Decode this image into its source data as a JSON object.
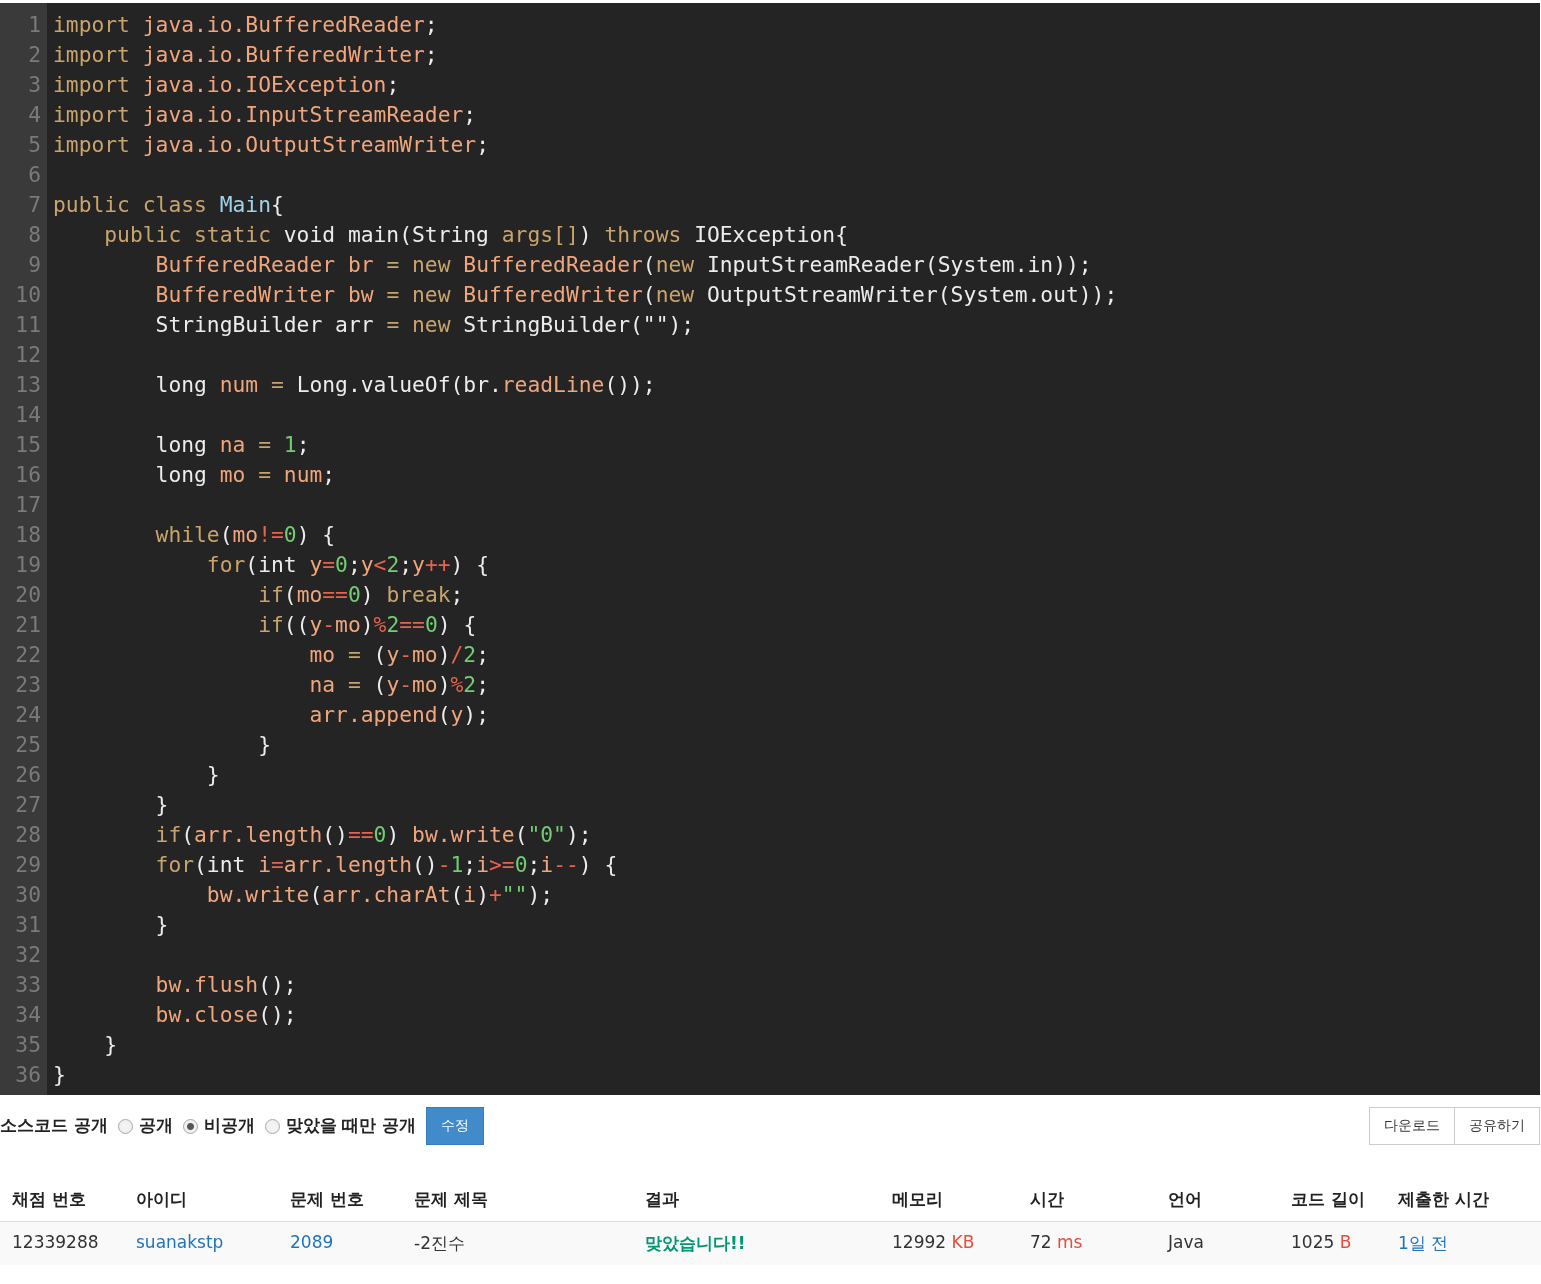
{
  "editor": {
    "lines": [
      {
        "number": "1",
        "tokens": [
          {
            "kind": "k",
            "text": "import "
          },
          {
            "kind": "v",
            "text": "java.io.BufferedReader"
          },
          {
            "kind": "w",
            "text": ";"
          }
        ]
      },
      {
        "number": "2",
        "tokens": [
          {
            "kind": "k",
            "text": "import "
          },
          {
            "kind": "v",
            "text": "java.io.BufferedWriter"
          },
          {
            "kind": "w",
            "text": ";"
          }
        ]
      },
      {
        "number": "3",
        "tokens": [
          {
            "kind": "k",
            "text": "import "
          },
          {
            "kind": "v",
            "text": "java.io.IOException"
          },
          {
            "kind": "w",
            "text": ";"
          }
        ]
      },
      {
        "number": "4",
        "tokens": [
          {
            "kind": "k",
            "text": "import "
          },
          {
            "kind": "v",
            "text": "java.io.InputStreamReader"
          },
          {
            "kind": "w",
            "text": ";"
          }
        ]
      },
      {
        "number": "5",
        "tokens": [
          {
            "kind": "k",
            "text": "import "
          },
          {
            "kind": "v",
            "text": "java.io.OutputStreamWriter"
          },
          {
            "kind": "w",
            "text": ";"
          }
        ]
      },
      {
        "number": "6"
      },
      {
        "number": "7",
        "tokens": [
          {
            "kind": "k",
            "text": "public class "
          },
          {
            "kind": "c",
            "text": "Main"
          },
          {
            "kind": "w",
            "text": "{"
          }
        ]
      },
      {
        "number": "8",
        "tokens": [
          {
            "kind": "k",
            "text": "    public static "
          },
          {
            "kind": "w",
            "text": "void main(String "
          },
          {
            "kind": "k",
            "text": "args[]"
          },
          {
            "kind": "w",
            "text": ") "
          },
          {
            "kind": "k",
            "text": "throws "
          },
          {
            "kind": "w",
            "text": "IOException{"
          }
        ]
      },
      {
        "number": "9",
        "tokens": [
          {
            "kind": "v",
            "text": "        BufferedReader br "
          },
          {
            "kind": "k",
            "text": "= new "
          },
          {
            "kind": "v",
            "text": "BufferedReader"
          },
          {
            "kind": "w",
            "text": "("
          },
          {
            "kind": "k",
            "text": "new "
          },
          {
            "kind": "w",
            "text": "InputStreamReader(System.in));"
          }
        ]
      },
      {
        "number": "10",
        "tokens": [
          {
            "kind": "v",
            "text": "        BufferedWriter bw "
          },
          {
            "kind": "k",
            "text": "= new "
          },
          {
            "kind": "v",
            "text": "BufferedWriter"
          },
          {
            "kind": "w",
            "text": "("
          },
          {
            "kind": "k",
            "text": "new "
          },
          {
            "kind": "w",
            "text": "OutputStreamWriter(System.out));"
          }
        ]
      },
      {
        "number": "11",
        "tokens": [
          {
            "kind": "w",
            "text": "        StringBuilder arr "
          },
          {
            "kind": "k",
            "text": "= new "
          },
          {
            "kind": "w",
            "text": "StringBuilder(\"\");"
          }
        ]
      },
      {
        "number": "12"
      },
      {
        "number": "13",
        "tokens": [
          {
            "kind": "w",
            "text": "        long "
          },
          {
            "kind": "v",
            "text": "num "
          },
          {
            "kind": "k",
            "text": "= "
          },
          {
            "kind": "w",
            "text": "Long.valueOf(br."
          },
          {
            "kind": "v",
            "text": "readLine"
          },
          {
            "kind": "w",
            "text": "());"
          }
        ]
      },
      {
        "number": "14"
      },
      {
        "number": "15",
        "tokens": [
          {
            "kind": "w",
            "text": "        long "
          },
          {
            "kind": "v",
            "text": "na "
          },
          {
            "kind": "k",
            "text": "= "
          },
          {
            "kind": "n",
            "text": "1"
          },
          {
            "kind": "w",
            "text": ";"
          }
        ]
      },
      {
        "number": "16",
        "tokens": [
          {
            "kind": "w",
            "text": "        long "
          },
          {
            "kind": "v",
            "text": "mo "
          },
          {
            "kind": "k",
            "text": "= "
          },
          {
            "kind": "v",
            "text": "num"
          },
          {
            "kind": "w",
            "text": ";"
          }
        ]
      },
      {
        "number": "17"
      },
      {
        "number": "18",
        "tokens": [
          {
            "kind": "k",
            "text": "        while"
          },
          {
            "kind": "w",
            "text": "("
          },
          {
            "kind": "v",
            "text": "mo"
          },
          {
            "kind": "o",
            "text": "!="
          },
          {
            "kind": "n",
            "text": "0"
          },
          {
            "kind": "w",
            "text": ") {"
          }
        ]
      },
      {
        "number": "19",
        "tokens": [
          {
            "kind": "k",
            "text": "            for"
          },
          {
            "kind": "w",
            "text": "(int "
          },
          {
            "kind": "v",
            "text": "y"
          },
          {
            "kind": "o",
            "text": "="
          },
          {
            "kind": "n",
            "text": "0"
          },
          {
            "kind": "w",
            "text": ";"
          },
          {
            "kind": "v",
            "text": "y"
          },
          {
            "kind": "o",
            "text": "<"
          },
          {
            "kind": "n",
            "text": "2"
          },
          {
            "kind": "w",
            "text": ";"
          },
          {
            "kind": "v",
            "text": "y"
          },
          {
            "kind": "o",
            "text": "++"
          },
          {
            "kind": "w",
            "text": ") {"
          }
        ]
      },
      {
        "number": "20",
        "tokens": [
          {
            "kind": "k",
            "text": "                if"
          },
          {
            "kind": "w",
            "text": "("
          },
          {
            "kind": "v",
            "text": "mo"
          },
          {
            "kind": "o",
            "text": "=="
          },
          {
            "kind": "n",
            "text": "0"
          },
          {
            "kind": "w",
            "text": ") "
          },
          {
            "kind": "k",
            "text": "break"
          },
          {
            "kind": "w",
            "text": ";"
          }
        ]
      },
      {
        "number": "21",
        "tokens": [
          {
            "kind": "k",
            "text": "                if"
          },
          {
            "kind": "w",
            "text": "(("
          },
          {
            "kind": "v",
            "text": "y"
          },
          {
            "kind": "o",
            "text": "-"
          },
          {
            "kind": "v",
            "text": "mo"
          },
          {
            "kind": "w",
            "text": ")"
          },
          {
            "kind": "o",
            "text": "%"
          },
          {
            "kind": "n",
            "text": "2"
          },
          {
            "kind": "o",
            "text": "=="
          },
          {
            "kind": "n",
            "text": "0"
          },
          {
            "kind": "w",
            "text": ") {"
          }
        ]
      },
      {
        "number": "22",
        "tokens": [
          {
            "kind": "v",
            "text": "                    mo "
          },
          {
            "kind": "k",
            "text": "= "
          },
          {
            "kind": "w",
            "text": "("
          },
          {
            "kind": "v",
            "text": "y"
          },
          {
            "kind": "o",
            "text": "-"
          },
          {
            "kind": "v",
            "text": "mo"
          },
          {
            "kind": "w",
            "text": ")"
          },
          {
            "kind": "o",
            "text": "/"
          },
          {
            "kind": "n",
            "text": "2"
          },
          {
            "kind": "w",
            "text": ";"
          }
        ]
      },
      {
        "number": "23",
        "tokens": [
          {
            "kind": "v",
            "text": "                    na "
          },
          {
            "kind": "k",
            "text": "= "
          },
          {
            "kind": "w",
            "text": "("
          },
          {
            "kind": "v",
            "text": "y"
          },
          {
            "kind": "o",
            "text": "-"
          },
          {
            "kind": "v",
            "text": "mo"
          },
          {
            "kind": "w",
            "text": ")"
          },
          {
            "kind": "o",
            "text": "%"
          },
          {
            "kind": "n",
            "text": "2"
          },
          {
            "kind": "w",
            "text": ";"
          }
        ]
      },
      {
        "number": "24",
        "tokens": [
          {
            "kind": "v",
            "text": "                    arr.append"
          },
          {
            "kind": "w",
            "text": "("
          },
          {
            "kind": "v",
            "text": "y"
          },
          {
            "kind": "w",
            "text": ");"
          }
        ]
      },
      {
        "number": "25",
        "tokens": [
          {
            "kind": "w",
            "text": "                }"
          }
        ]
      },
      {
        "number": "26",
        "tokens": [
          {
            "kind": "w",
            "text": "            }"
          }
        ]
      },
      {
        "number": "27",
        "tokens": [
          {
            "kind": "w",
            "text": "        }"
          }
        ]
      },
      {
        "number": "28",
        "tokens": [
          {
            "kind": "k",
            "text": "        if"
          },
          {
            "kind": "w",
            "text": "("
          },
          {
            "kind": "v",
            "text": "arr.length"
          },
          {
            "kind": "w",
            "text": "()"
          },
          {
            "kind": "o",
            "text": "=="
          },
          {
            "kind": "n",
            "text": "0"
          },
          {
            "kind": "w",
            "text": ") "
          },
          {
            "kind": "v",
            "text": "bw.write"
          },
          {
            "kind": "w",
            "text": "("
          },
          {
            "kind": "n",
            "text": "\"0\""
          },
          {
            "kind": "w",
            "text": ");"
          }
        ]
      },
      {
        "number": "29",
        "tokens": [
          {
            "kind": "k",
            "text": "        for"
          },
          {
            "kind": "w",
            "text": "(int "
          },
          {
            "kind": "v",
            "text": "i"
          },
          {
            "kind": "o",
            "text": "="
          },
          {
            "kind": "v",
            "text": "arr.length"
          },
          {
            "kind": "w",
            "text": "()"
          },
          {
            "kind": "o",
            "text": "-"
          },
          {
            "kind": "n",
            "text": "1"
          },
          {
            "kind": "w",
            "text": ";"
          },
          {
            "kind": "v",
            "text": "i"
          },
          {
            "kind": "o",
            "text": ">="
          },
          {
            "kind": "n",
            "text": "0"
          },
          {
            "kind": "w",
            "text": ";"
          },
          {
            "kind": "v",
            "text": "i"
          },
          {
            "kind": "o",
            "text": "--"
          },
          {
            "kind": "w",
            "text": ") {"
          }
        ]
      },
      {
        "number": "30",
        "tokens": [
          {
            "kind": "v",
            "text": "            bw.write"
          },
          {
            "kind": "w",
            "text": "("
          },
          {
            "kind": "v",
            "text": "arr.charAt"
          },
          {
            "kind": "w",
            "text": "("
          },
          {
            "kind": "v",
            "text": "i"
          },
          {
            "kind": "w",
            "text": ")"
          },
          {
            "kind": "o",
            "text": "+"
          },
          {
            "kind": "n",
            "text": "\"\""
          },
          {
            "kind": "w",
            "text": ");"
          }
        ]
      },
      {
        "number": "31",
        "tokens": [
          {
            "kind": "w",
            "text": "        }"
          }
        ]
      },
      {
        "number": "32"
      },
      {
        "number": "33",
        "tokens": [
          {
            "kind": "v",
            "text": "        bw.flush"
          },
          {
            "kind": "w",
            "text": "();"
          }
        ]
      },
      {
        "number": "34",
        "tokens": [
          {
            "kind": "v",
            "text": "        bw.close"
          },
          {
            "kind": "w",
            "text": "();"
          }
        ]
      },
      {
        "number": "35",
        "tokens": [
          {
            "kind": "w",
            "text": "    }"
          }
        ]
      },
      {
        "number": "36",
        "tokens": [
          {
            "kind": "w",
            "text": "}"
          }
        ]
      }
    ]
  },
  "visibility": {
    "label": "소스코드 공개",
    "options": [
      {
        "label": "공개",
        "selected": false
      },
      {
        "label": "비공개",
        "selected": true
      },
      {
        "label": "맞았을 때만 공개",
        "selected": false
      }
    ],
    "save_button": "수정"
  },
  "actions": [
    "다운로드",
    "공유하기"
  ],
  "table": {
    "columns": [
      "채점 번호",
      "아이디",
      "문제 번호",
      "문제 제목",
      "결과",
      "메모리",
      "시간",
      "언어",
      "코드 길이",
      "제출한 시간"
    ],
    "rows": [
      {
        "cells": [
          {
            "kind": "plain",
            "text": "12339288"
          },
          {
            "kind": "link",
            "text": "suanakstp"
          },
          {
            "kind": "link",
            "text": "2089"
          },
          {
            "kind": "plain",
            "text": "-2진수"
          },
          {
            "kind": "result",
            "text": "맞았습니다!!"
          },
          {
            "kind": "unit",
            "text": "12992",
            "unit": "KB"
          },
          {
            "kind": "unit",
            "text": "72",
            "unit": "ms"
          },
          {
            "kind": "plain",
            "text": "Java"
          },
          {
            "kind": "unit",
            "text": "1025",
            "unit": "B"
          },
          {
            "kind": "link",
            "text": "1일 전"
          }
        ]
      }
    ]
  }
}
